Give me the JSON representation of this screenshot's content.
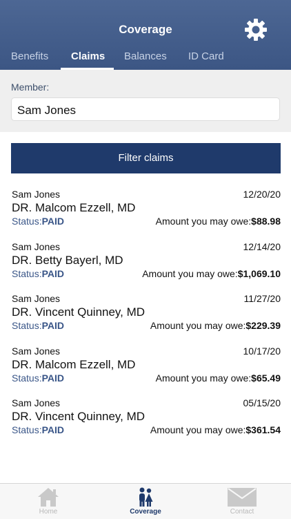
{
  "header": {
    "title": "Coverage",
    "settings_icon": "gear-icon"
  },
  "tabs": [
    {
      "label": "Benefits",
      "active": false
    },
    {
      "label": "Claims",
      "active": true
    },
    {
      "label": "Balances",
      "active": false
    },
    {
      "label": "ID Card",
      "active": false
    }
  ],
  "member": {
    "label": "Member:",
    "value": "Sam Jones"
  },
  "filter": {
    "label": "Filter claims"
  },
  "claims": [
    {
      "member": "Sam Jones",
      "date": "12/20/20",
      "provider": "DR. Malcom Ezzell, MD",
      "status_label": "Status:",
      "status": "PAID",
      "amount_label": "Amount you may owe:",
      "amount": "$88.98"
    },
    {
      "member": "Sam Jones",
      "date": "12/14/20",
      "provider": "DR. Betty Bayerl, MD",
      "status_label": "Status:",
      "status": "PAID",
      "amount_label": "Amount you may owe:",
      "amount": "$1,069.10"
    },
    {
      "member": "Sam Jones",
      "date": "11/27/20",
      "provider": "DR. Vincent Quinney, MD",
      "status_label": "Status:",
      "status": "PAID",
      "amount_label": "Amount you may owe:",
      "amount": "$229.39"
    },
    {
      "member": "Sam Jones",
      "date": "10/17/20",
      "provider": "DR. Malcom Ezzell, MD",
      "status_label": "Status:",
      "status": "PAID",
      "amount_label": "Amount you may owe:",
      "amount": "$65.49"
    },
    {
      "member": "Sam Jones",
      "date": "05/15/20",
      "provider": "DR. Vincent Quinney, MD",
      "status_label": "Status:",
      "status": "PAID",
      "amount_label": "Amount you may owe:",
      "amount": "$361.54"
    }
  ],
  "tabbar": [
    {
      "label": "Home",
      "icon": "home-icon",
      "active": false
    },
    {
      "label": "Coverage",
      "icon": "family-icon",
      "active": true
    },
    {
      "label": "Contact",
      "icon": "envelope-icon",
      "active": false
    }
  ],
  "colors": {
    "header": "#3c5684",
    "button": "#1f3a6b",
    "status": "#3a5688"
  }
}
